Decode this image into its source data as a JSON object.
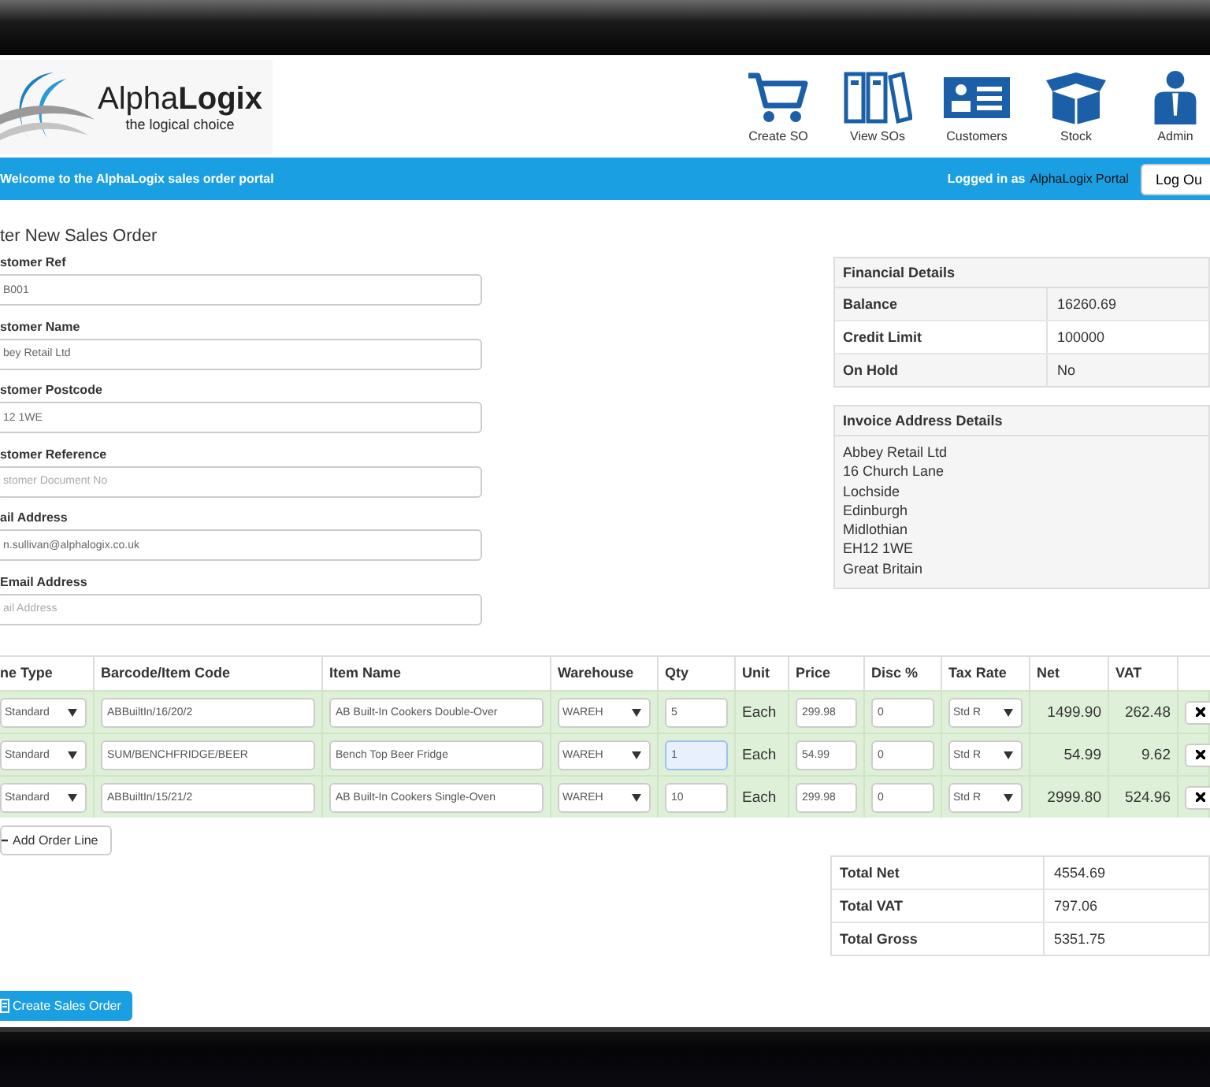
{
  "brand": {
    "name": "Alpha**Logix**",
    "tagline": "the logical choice"
  },
  "nav": [
    {
      "label": "Create SO",
      "kind": "cart"
    },
    {
      "label": "View SOs",
      "kind": "binders"
    },
    {
      "label": "Customers",
      "kind": "card"
    },
    {
      "label": "Stock",
      "kind": "box"
    },
    {
      "label": "Admin",
      "kind": "person"
    }
  ],
  "bar": {
    "welcome": "Welcome to the AlphaLogix sales order portal",
    "logged_in_label": "Logged in as",
    "user": "AlphaLogix Portal",
    "logout": "Log Ou"
  },
  "form": {
    "title": "ter New Sales Order",
    "fields": [
      {
        "label": "stomer Ref",
        "value": "B001"
      },
      {
        "label": "stomer Name",
        "value": "bey Retail Ltd"
      },
      {
        "label": "stomer Postcode",
        "value": "12 1WE"
      },
      {
        "label": "stomer Reference",
        "placeholder": "stomer Document No"
      },
      {
        "label": "ail Address",
        "value": "n.sullivan@alphalogix.co.uk"
      },
      {
        "label": "Email Address",
        "placeholder": "ail Address"
      }
    ]
  },
  "financial": {
    "title": "Financial Details",
    "rows": [
      {
        "label": "Balance",
        "value": "16260.69"
      },
      {
        "label": "Credit Limit",
        "value": "100000"
      },
      {
        "label": "On Hold",
        "value": "No"
      }
    ]
  },
  "invoice": {
    "title": "Invoice Address Details",
    "lines": [
      "Abbey Retail Ltd",
      "16 Church Lane",
      "Lochside",
      "Edinburgh",
      "Midlothian",
      "EH12 1WE",
      "Great Britain"
    ]
  },
  "table": {
    "columns": [
      "ne Type",
      "Barcode/Item Code",
      "Item Name",
      "Warehouse",
      "Qty",
      "Unit",
      "Price",
      "Disc %",
      "Tax Rate",
      "Net",
      "VAT"
    ],
    "rows": [
      {
        "line_type": "Standard",
        "barcode": "ABBuiltIn/16/20/2",
        "item_name": "AB Built-In Cookers Double-Over",
        "warehouse": "WAREH",
        "qty": "5",
        "qty_focused": false,
        "unit": "Each",
        "price": "299.98",
        "disc": "0",
        "tax_rate": "Std R",
        "net": "1499.90",
        "vat": "262.48"
      },
      {
        "line_type": "Standard",
        "barcode": "SUM/BENCHFRIDGE/BEER",
        "item_name": "Bench Top Beer Fridge",
        "warehouse": "WAREH",
        "qty": "1",
        "qty_focused": true,
        "unit": "Each",
        "price": "54.99",
        "disc": "0",
        "tax_rate": "Std R",
        "net": "54.99",
        "vat": "9.62"
      },
      {
        "line_type": "Standard",
        "barcode": "ABBuiltIn/15/21/2",
        "item_name": "AB Built-In Cookers Single-Oven",
        "warehouse": "WAREH",
        "qty": "10",
        "qty_focused": false,
        "unit": "Each",
        "price": "299.98",
        "disc": "0",
        "tax_rate": "Std R",
        "net": "2999.80",
        "vat": "524.96"
      }
    ]
  },
  "add_line": "Add Order Line",
  "totals": [
    {
      "label": "Total Net",
      "value": "4554.69"
    },
    {
      "label": "Total VAT",
      "value": "797.06"
    },
    {
      "label": "Total Gross",
      "value": "5351.75"
    }
  ],
  "create_button": "Create Sales Order"
}
